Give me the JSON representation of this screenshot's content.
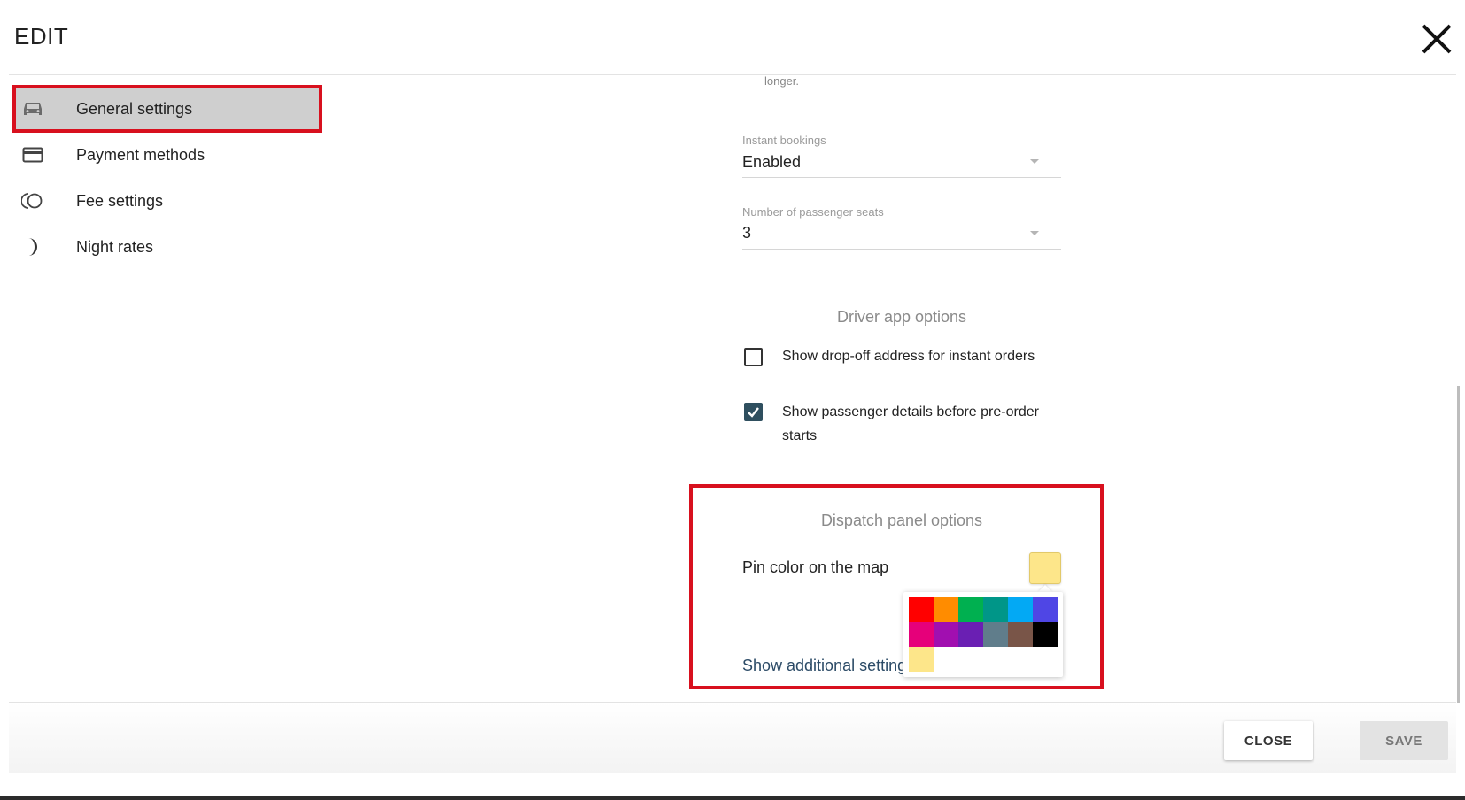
{
  "dialog": {
    "title": "EDIT",
    "close_icon": "close-icon"
  },
  "sidebar": {
    "items": [
      {
        "label": "General settings",
        "icon": "car-icon",
        "active": true
      },
      {
        "label": "Payment methods",
        "icon": "credit-card-icon",
        "active": false
      },
      {
        "label": "Fee settings",
        "icon": "fee-icon",
        "active": false
      },
      {
        "label": "Night rates",
        "icon": "moon-icon",
        "active": false
      }
    ]
  },
  "form": {
    "helper_text": "longer.",
    "instant_bookings": {
      "label": "Instant bookings",
      "value": "Enabled"
    },
    "passenger_seats": {
      "label": "Number of passenger seats",
      "value": "3"
    },
    "driver_app": {
      "title": "Driver app options",
      "options": [
        {
          "label": "Show drop-off address for instant orders",
          "checked": false
        },
        {
          "label": "Show passenger details before pre-order starts",
          "checked": true
        }
      ]
    },
    "dispatch_panel": {
      "title": "Dispatch panel options",
      "pin_color_label": "Pin color on the map",
      "pin_color": "#fde68a",
      "show_more": "Show additional settings",
      "palette": [
        "#ff0000",
        "#ff8c00",
        "#00b050",
        "#009688",
        "#03a9f4",
        "#4f46e5",
        "#e6007a",
        "#a10fb0",
        "#6a1fb3",
        "#607d8b",
        "#795548",
        "#000000",
        "#fde68a"
      ]
    }
  },
  "footer": {
    "close_label": "CLOSE",
    "save_label": "SAVE"
  }
}
